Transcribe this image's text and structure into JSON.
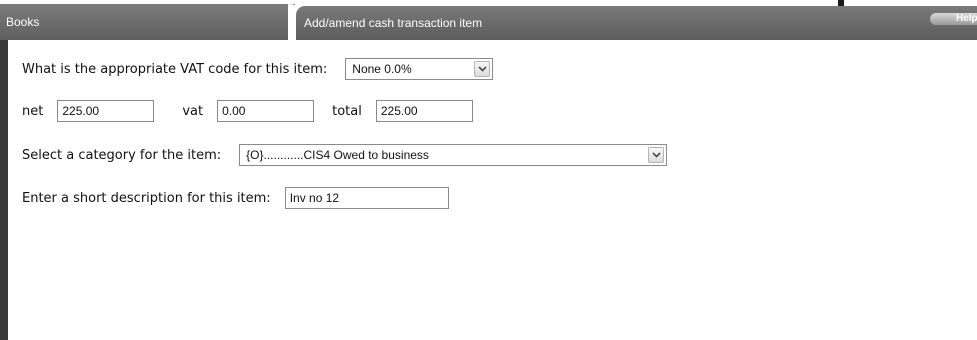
{
  "header": {
    "books_tab": "Books",
    "current_tab": "Add/amend cash transaction item",
    "help_label": "Help"
  },
  "form": {
    "vat_code": {
      "label": "What is the appropriate VAT code for this item:",
      "selected": "None 0.0%"
    },
    "amounts": {
      "net_label": "net",
      "net_value": "225.00",
      "vat_label": "vat",
      "vat_value": "0.00",
      "total_label": "total",
      "total_value": "225.00"
    },
    "category": {
      "label": "Select a category for the item:",
      "selected": "{O}............CIS4 Owed to business"
    },
    "description": {
      "label": "Enter a short description for this item:",
      "value": "Inv no 12"
    }
  },
  "icons": {
    "dropdown_arrow": "chevron-down-icon"
  },
  "colors": {
    "header_bar": "#6b6b6b",
    "panel_border": "#3a3a3a",
    "field_border": "#8a8a8a"
  }
}
